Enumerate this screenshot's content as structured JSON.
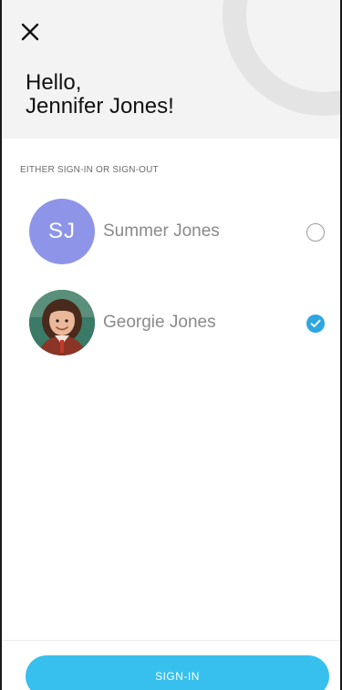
{
  "header": {
    "close_icon": "close-icon",
    "greeting_line1": "Hello,",
    "greeting_line2": "Jennifer Jones!"
  },
  "section": {
    "label": "EITHER SIGN-IN OR SIGN-OUT"
  },
  "people": [
    {
      "initials": "SJ",
      "name": "Summer Jones",
      "selected": false,
      "avatar_color": "#8e95e8"
    },
    {
      "initials": "",
      "name": "Georgie Jones",
      "selected": true,
      "avatar_icon": "child-photo-avatar"
    }
  ],
  "footer": {
    "signin_label": "SIGN-IN"
  },
  "colors": {
    "accent": "#37c0ee",
    "check": "#2ea7e0",
    "header_bg": "#f3f3f3"
  }
}
